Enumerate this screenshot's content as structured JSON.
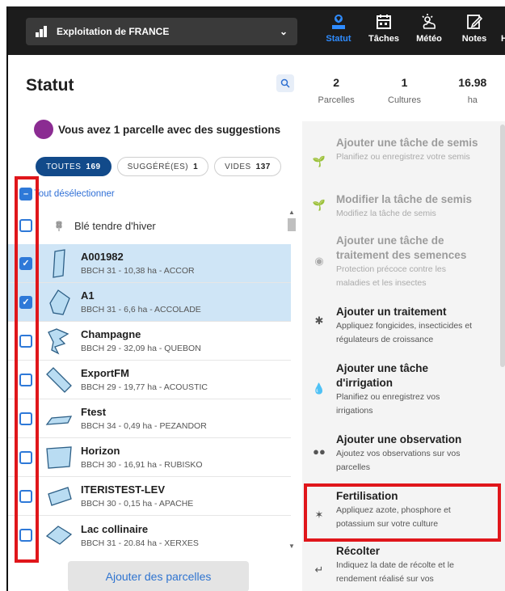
{
  "topbar": {
    "farm_name": "Exploitation de FRANCE",
    "tabs": [
      {
        "label": "Statut",
        "icon": "map-pin-icon",
        "active": true
      },
      {
        "label": "Tâches",
        "icon": "calendar-icon",
        "active": false
      },
      {
        "label": "Météo",
        "icon": "weather-icon",
        "active": false
      },
      {
        "label": "Notes",
        "icon": "note-edit-icon",
        "active": false
      }
    ],
    "cut_tab_letter": "H"
  },
  "left": {
    "title": "Statut",
    "suggestion_text": "Vous avez 1 parcelle avec des suggestions",
    "filters": [
      {
        "label": "TOUTES",
        "count": "169",
        "active": true
      },
      {
        "label": "SUGGÉRÉ(ES)",
        "count": "1",
        "active": false
      },
      {
        "label": "VIDES",
        "count": "137",
        "active": false
      }
    ],
    "deselect_all": "Tout désélectionner",
    "crop_group": "Blé tendre d'hiver",
    "parcels": [
      {
        "name": "A001982",
        "info": "BBCH 31 - 10,38 ha - ACCOR",
        "checked": true
      },
      {
        "name": "A1",
        "info": "BBCH 31 - 6,6 ha - ACCOLADE",
        "checked": true
      },
      {
        "name": "Champagne",
        "info": "BBCH 29 - 32,09 ha - QUEBON",
        "checked": false
      },
      {
        "name": "ExportFM",
        "info": "BBCH 29 - 19,77 ha - ACOUSTIC",
        "checked": false
      },
      {
        "name": "Ftest",
        "info": "BBCH 34 - 0,49 ha - PEZANDOR",
        "checked": false
      },
      {
        "name": "Horizon",
        "info": "BBCH 30 - 16,91 ha - RUBISKO",
        "checked": false
      },
      {
        "name": "ITERISTEST-LEV",
        "info": "BBCH 30 - 0,15 ha - APACHE",
        "checked": false
      },
      {
        "name": "Lac collinaire",
        "info": "BBCH 31 - 20.84 ha - XERXES",
        "checked": false
      }
    ],
    "add_button": "Ajouter des parcelles"
  },
  "right": {
    "stats": [
      {
        "value": "2",
        "label": "Parcelles"
      },
      {
        "value": "1",
        "label": "Cultures"
      },
      {
        "value": "16.98",
        "label": "ha"
      }
    ],
    "actions": [
      {
        "title": "Ajouter une tâche de semis",
        "desc": "Planifiez ou enregistrez votre semis",
        "disabled": true,
        "icon": "sowing-icon"
      },
      {
        "title": "Modifier la tâche de semis",
        "desc": "Modifiez la tâche de semis",
        "disabled": true,
        "icon": "sowing-edit-icon"
      },
      {
        "title": "Ajouter une tâche de traitement des semences",
        "desc": "Protection précoce contre les maladies et les insectes",
        "disabled": true,
        "icon": "seed-treatment-icon"
      },
      {
        "title": "Ajouter un traitement",
        "desc": "Appliquez fongicides, insecticides et régulateurs de croissance",
        "disabled": false,
        "icon": "sprayer-icon"
      },
      {
        "title": "Ajouter une tâche d'irrigation",
        "desc": "Planifiez ou enregistrez vos irrigations",
        "disabled": false,
        "icon": "water-drop-icon"
      },
      {
        "title": "Ajouter une observation",
        "desc": "Ajoutez vos observations sur vos parcelles",
        "disabled": false,
        "icon": "binoculars-icon"
      },
      {
        "title": "Fertilisation",
        "desc": "Appliquez azote, phosphore et potassium sur votre culture",
        "disabled": false,
        "icon": "fertilizer-icon"
      },
      {
        "title": "Récolter",
        "desc": "Indiquez la date de récolte et le rendement réalisé sur vos",
        "disabled": false,
        "icon": "harvest-icon"
      }
    ]
  },
  "colors": {
    "accent_blue": "#2e79d8",
    "highlight_red": "#e0161b",
    "suggestion_purple": "#8b2c92",
    "selected_row": "#cfe5f6"
  }
}
